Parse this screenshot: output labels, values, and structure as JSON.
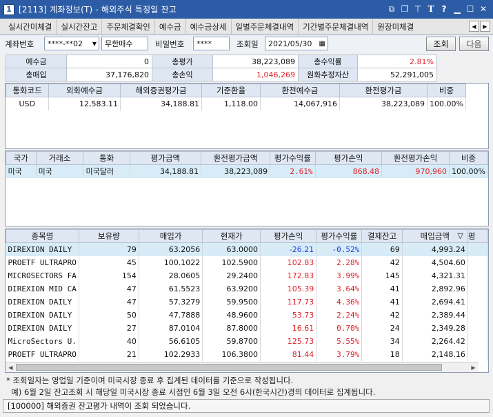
{
  "window": {
    "number": "1",
    "title": "[2113] 계좌정보(T) - 해외주식 특정일 잔고",
    "icons": [
      "restore-window-icon",
      "copy-window-icon",
      "pin-icon",
      "font-icon",
      "help-icon",
      "minimize-icon",
      "maximize-icon",
      "close-icon"
    ]
  },
  "tabs": [
    "실시간미체결",
    "실시간잔고",
    "주문체결확인",
    "예수금",
    "예수금상세",
    "일별주문체결내역",
    "기간별주문체결내역",
    "원장미체결"
  ],
  "toolbar": {
    "account_label": "계좌번호",
    "account_value": "****-**02",
    "account_type": "무한매수",
    "password_label": "비밀번호",
    "password_value": "****",
    "date_label": "조회일",
    "date_value": "2021/05/30",
    "query_button": "조회",
    "next_button": "다음"
  },
  "summary": {
    "deposit_label": "예수금",
    "deposit_value": "0",
    "total_eval_label": "총평가",
    "total_eval_value": "38,223,089",
    "total_return_label": "총수익률",
    "total_return_value": "2.81%",
    "total_buy_label": "총매입",
    "total_buy_value": "37,176,820",
    "total_pl_label": "총손익",
    "total_pl_value": "1,046,269",
    "krw_assets_label": "원화추정자산",
    "krw_assets_value": "52,291,005"
  },
  "currency_grid": {
    "headers": [
      "통화코드",
      "외화예수금",
      "해외증권평가금",
      "기준환율",
      "환전예수금",
      "환전평가금",
      "비중"
    ],
    "rows": [
      [
        "USD",
        "12,583.11",
        "34,188.81",
        "1,118.00",
        "14,067,916",
        "38,223,089",
        "100.00%"
      ]
    ]
  },
  "country_grid": {
    "headers": [
      "국가",
      "거래소",
      "통화",
      "평가금액",
      "환전평가금액",
      "평가수익률",
      "평가손익",
      "환전평가손익",
      "비중"
    ],
    "rows": [
      [
        "미국",
        "미국",
        "미국달러",
        "34,188.81",
        "38,223,089",
        "2.61%",
        "868.48",
        "970,960",
        "100.00%"
      ]
    ]
  },
  "holdings_grid": {
    "headers": [
      "종목명",
      "보유량",
      "매입가",
      "현재가",
      "평가손익",
      "평가수익률",
      "결제잔고",
      "매입금액",
      "평"
    ],
    "sort_icon": "sort-desc-icon",
    "rows": [
      [
        "DIREXION DAILY",
        "79",
        "63.2056",
        "63.0000",
        "-26.21",
        "-0.52%",
        "69",
        "4,993.24"
      ],
      [
        "PROETF ULTRAPRO",
        "45",
        "100.1022",
        "102.5900",
        "102.83",
        "2.28%",
        "42",
        "4,504.60"
      ],
      [
        "MICROSECTORS FA",
        "154",
        "28.0605",
        "29.2400",
        "172.83",
        "3.99%",
        "145",
        "4,321.31"
      ],
      [
        "DIREXION MID CA",
        "47",
        "61.5523",
        "63.9200",
        "105.39",
        "3.64%",
        "41",
        "2,892.96"
      ],
      [
        "DIREXION DAILY",
        "47",
        "57.3279",
        "59.9500",
        "117.73",
        "4.36%",
        "41",
        "2,694.41"
      ],
      [
        "DIREXION DAILY",
        "50",
        "47.7888",
        "48.9600",
        "53.73",
        "2.24%",
        "42",
        "2,389.44"
      ],
      [
        "DIREXION DAILY",
        "27",
        "87.0104",
        "87.8000",
        "16.61",
        "0.70%",
        "24",
        "2,349.28"
      ],
      [
        "MicroSectors U.",
        "40",
        "56.6105",
        "59.8700",
        "125.73",
        "5.55%",
        "34",
        "2,264.42"
      ],
      [
        "PROETF ULTRAPRO",
        "21",
        "102.2933",
        "106.3800",
        "81.44",
        "3.79%",
        "18",
        "2,148.16"
      ]
    ]
  },
  "notes": [
    "* 조회일자는 영업일 기준이며 미국시장 종료 후 집계된 데이터를 기준으로 작성됩니다.",
    "  예) 6월 2일 잔고조회 시 해당일 미국시장 종료 시점인 6월 3일 오전 6시(한국시간)경의 데이터로 집계됩니다."
  ],
  "status": "[100000] 해외증권 잔고평가 내역이 조회 되었습니다.",
  "colors": {
    "title_bar": "#2d5ca6",
    "header_bg": "#dfe7f2",
    "positive": "#e0202a",
    "negative": "#1a3ee0",
    "selected_row": "#d7ecf7"
  }
}
